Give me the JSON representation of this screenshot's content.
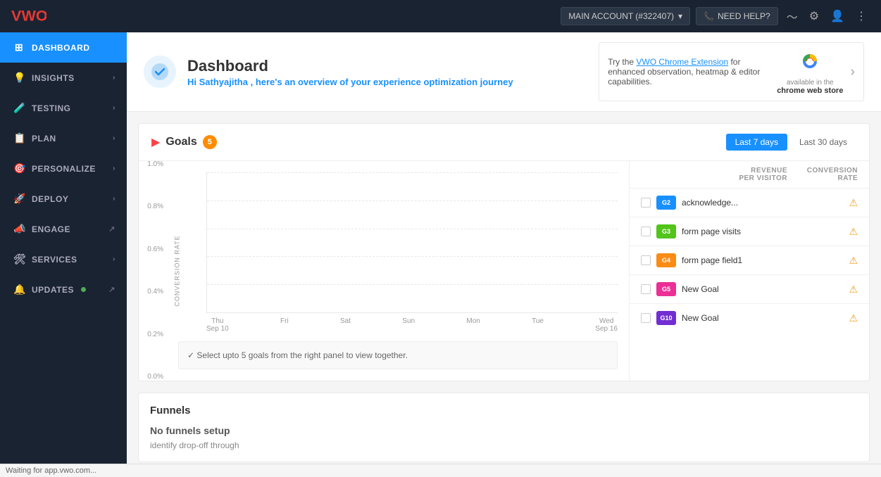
{
  "header": {
    "logo": "VWO",
    "account_btn": "MAIN ACCOUNT (#322407)",
    "account_dropdown_icon": "▾",
    "need_help_label": "NEED HELP?",
    "phone_icon": "📞"
  },
  "sidebar": {
    "items": [
      {
        "id": "dashboard",
        "label": "DASHBOARD",
        "icon": "⊞",
        "active": true,
        "has_chevron": false,
        "has_external": false,
        "has_dot": false
      },
      {
        "id": "insights",
        "label": "INSIGHTS",
        "icon": "💡",
        "active": false,
        "has_chevron": true,
        "has_external": false,
        "has_dot": false
      },
      {
        "id": "testing",
        "label": "TESTING",
        "icon": "🧪",
        "active": false,
        "has_chevron": true,
        "has_external": false,
        "has_dot": false
      },
      {
        "id": "plan",
        "label": "PLAN",
        "icon": "📋",
        "active": false,
        "has_chevron": true,
        "has_external": false,
        "has_dot": false
      },
      {
        "id": "personalize",
        "label": "PERSONALIZE",
        "icon": "🎯",
        "active": false,
        "has_chevron": true,
        "has_external": false,
        "has_dot": false
      },
      {
        "id": "deploy",
        "label": "DEPLOY",
        "icon": "🚀",
        "active": false,
        "has_chevron": true,
        "has_external": false,
        "has_dot": false
      },
      {
        "id": "engage",
        "label": "ENGAGE",
        "icon": "📣",
        "active": false,
        "has_chevron": false,
        "has_external": true,
        "has_dot": false
      },
      {
        "id": "services",
        "label": "SERVICES",
        "icon": "🛠",
        "active": false,
        "has_chevron": true,
        "has_external": false,
        "has_dot": false
      },
      {
        "id": "updates",
        "label": "UPDATES",
        "icon": "🔔",
        "active": false,
        "has_chevron": false,
        "has_external": true,
        "has_dot": true
      }
    ]
  },
  "dashboard": {
    "title": "Dashboard",
    "subtitle_prefix": "Hi ",
    "username": "Sathyajitha",
    "subtitle_suffix": " , here's an overview of your experience optimization journey",
    "icon": "✓"
  },
  "chrome_banner": {
    "text_prefix": "Try the ",
    "link_text": "VWO Chrome Extension",
    "text_suffix": " for enhanced observation, heatmap & editor capabilities.",
    "available_label": "available in the",
    "store_label": "chrome web store",
    "arrow": "›"
  },
  "goals": {
    "title": "Goals",
    "badge": "5",
    "date_options": [
      {
        "label": "Last 7 days",
        "active": true
      },
      {
        "label": "Last 30 days",
        "active": false
      }
    ],
    "chart": {
      "y_label": "CONVERSION RATE",
      "y_ticks": [
        "1.0%",
        "0.8%",
        "0.6%",
        "0.4%",
        "0.2%",
        "0.0%"
      ],
      "x_ticks": [
        {
          "day": "Thu",
          "date": "Sep 10"
        },
        {
          "day": "Fri",
          "date": ""
        },
        {
          "day": "Sat",
          "date": ""
        },
        {
          "day": "Sun",
          "date": ""
        },
        {
          "day": "Mon",
          "date": ""
        },
        {
          "day": "Tue",
          "date": ""
        },
        {
          "day": "Wed",
          "date": "Sep 16"
        }
      ],
      "hint": "✓  Select upto 5 goals from the right panel to view together."
    },
    "list_headers": {
      "col1": "REVENUE",
      "col1_sub": "PER VISITOR",
      "col2": "CONVERSION",
      "col2_sub": "RATE"
    },
    "items": [
      {
        "id": "G2",
        "name": "acknowledge...",
        "tag_color": "tag-blue",
        "warn": true
      },
      {
        "id": "G3",
        "name": "form page visits",
        "tag_color": "tag-green",
        "warn": true
      },
      {
        "id": "G4",
        "name": "form page field1",
        "tag_color": "tag-orange",
        "warn": true
      },
      {
        "id": "G5",
        "name": "New Goal",
        "tag_color": "tag-pink",
        "warn": true
      },
      {
        "id": "G10",
        "name": "New Goal",
        "tag_color": "tag-purple",
        "warn": true
      }
    ]
  },
  "funnels": {
    "title": "Funnels",
    "no_funnels_label": "No funnels setup",
    "description": "identify drop-off through"
  },
  "status_bar": {
    "text": "Waiting for app.vwo.com..."
  }
}
